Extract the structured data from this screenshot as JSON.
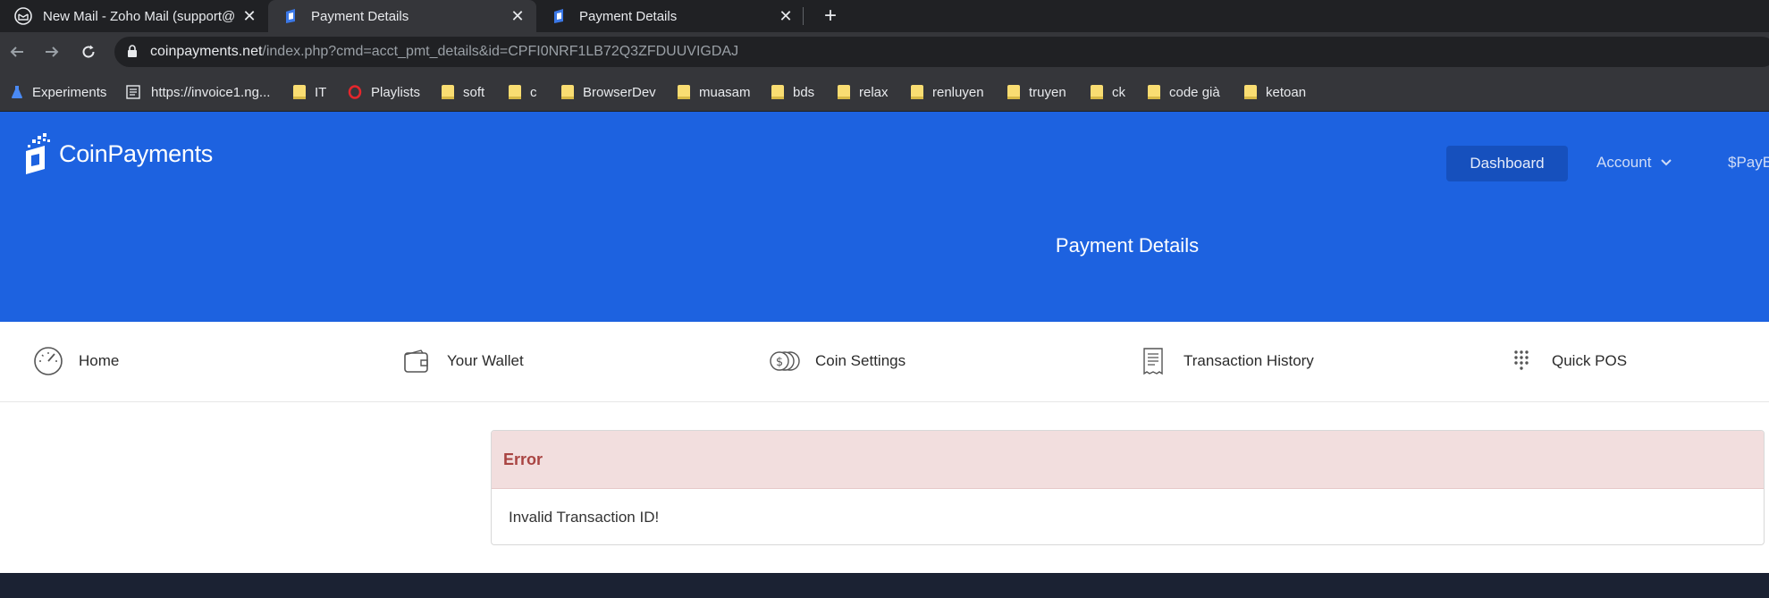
{
  "browser": {
    "tabs": [
      {
        "title": "New Mail - Zoho Mail (support@",
        "icon": "mail-icon",
        "active": false
      },
      {
        "title": "Payment Details",
        "icon": "coinpayments-favicon-icon",
        "active": true
      },
      {
        "title": "Payment Details",
        "icon": "coinpayments-favicon-icon",
        "active": false
      }
    ],
    "url_host": "coinpayments.net",
    "url_path": "/index.php?cmd=acct_pmt_details&id=CPFI0NRF1LB72Q3ZFDUUVIGDAJ",
    "bookmarks": [
      {
        "label": "Experiments",
        "icon": "flask-icon"
      },
      {
        "label": "https://invoice1.ng...",
        "icon": "document-icon"
      },
      {
        "label": "IT",
        "icon": "folder-icon"
      },
      {
        "label": "Playlists",
        "icon": "opera-icon"
      },
      {
        "label": "soft",
        "icon": "folder-icon"
      },
      {
        "label": "c",
        "icon": "folder-icon"
      },
      {
        "label": "BrowserDev",
        "icon": "folder-icon"
      },
      {
        "label": "muasam",
        "icon": "folder-icon"
      },
      {
        "label": "bds",
        "icon": "folder-icon"
      },
      {
        "label": "relax",
        "icon": "folder-icon"
      },
      {
        "label": "renluyen",
        "icon": "folder-icon"
      },
      {
        "label": "truyen",
        "icon": "folder-icon"
      },
      {
        "label": "ck",
        "icon": "folder-icon"
      },
      {
        "label": "code già",
        "icon": "folder-icon"
      },
      {
        "label": "ketoan",
        "icon": "folder-icon"
      }
    ]
  },
  "site": {
    "logo_text": "CoinPayments",
    "nav": {
      "dashboard": "Dashboard",
      "account": "Account",
      "paybyname": "$PayB"
    },
    "page_title": "Payment Details",
    "subnav": [
      {
        "label": "Home",
        "icon": "speedometer-icon"
      },
      {
        "label": "Your Wallet",
        "icon": "wallet-icon"
      },
      {
        "label": "Coin Settings",
        "icon": "coins-icon"
      },
      {
        "label": "Transaction History",
        "icon": "receipt-icon"
      },
      {
        "label": "Quick POS",
        "icon": "keypad-icon"
      }
    ],
    "error": {
      "heading": "Error",
      "message": "Invalid Transaction ID!"
    }
  },
  "colors": {
    "header_blue": "#1d62e0",
    "error_bg": "#f2dede",
    "error_text": "#a94442",
    "footer": "#1b2233"
  }
}
